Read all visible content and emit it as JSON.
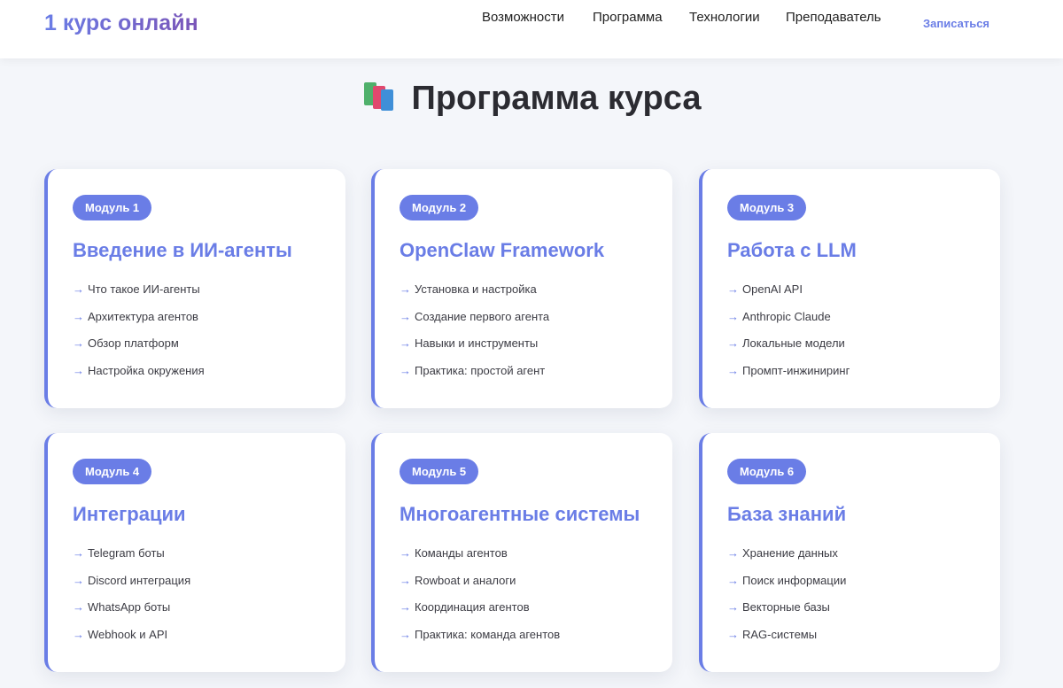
{
  "header": {
    "logo": "1 курс онлайн",
    "nav": [
      {
        "label": "Возможности"
      },
      {
        "label": "Программа"
      },
      {
        "label": "Технологии"
      },
      {
        "label": "Преподаватель"
      }
    ],
    "cta": "Записаться"
  },
  "section": {
    "icon": "books-icon",
    "title": "Программа курса"
  },
  "accent_color": "#6a7de6",
  "modules": [
    {
      "badge": "Модуль 1",
      "title": "Введение в ИИ-агенты",
      "items": [
        "Что такое ИИ-агенты",
        "Архитектура агентов",
        "Обзор платформ",
        "Настройка окружения"
      ]
    },
    {
      "badge": "Модуль 2",
      "title": "OpenClaw Framework",
      "items": [
        "Установка и настройка",
        "Создание первого агента",
        "Навыки и инструменты",
        "Практика: простой агент"
      ]
    },
    {
      "badge": "Модуль 3",
      "title": "Работа с LLM",
      "items": [
        "OpenAI API",
        "Anthropic Claude",
        "Локальные модели",
        "Промпт-инжиниринг"
      ]
    },
    {
      "badge": "Модуль 4",
      "title": "Интеграции",
      "items": [
        "Telegram боты",
        "Discord интеграция",
        "WhatsApp боты",
        "Webhook и API"
      ]
    },
    {
      "badge": "Модуль 5",
      "title": "Многоагентные системы",
      "items": [
        "Команды агентов",
        "Rowboat и аналоги",
        "Координация агентов",
        "Практика: команда агентов"
      ]
    },
    {
      "badge": "Модуль 6",
      "title": "База знаний",
      "items": [
        "Хранение данных",
        "Поиск информации",
        "Векторные базы",
        "RAG-системы"
      ]
    }
  ]
}
